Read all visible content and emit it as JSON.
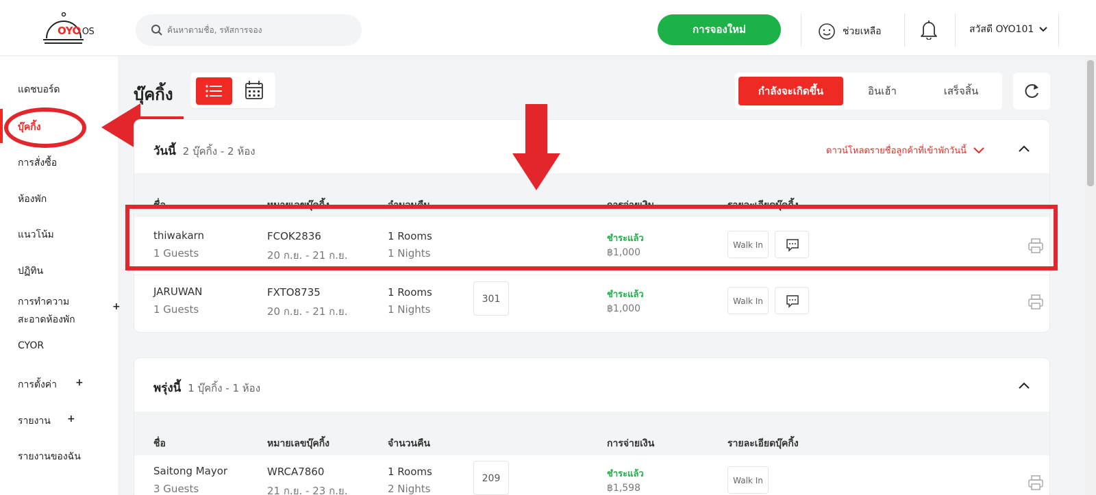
{
  "header": {
    "logo_text": "OYO",
    "logo_os": "OS",
    "search_placeholder": "ค้นหาตามชื่อ, รหัสการจอง",
    "new_booking": "การจองใหม่",
    "help": "ช่วยเหลือ",
    "user": "สวัสดี OYO101"
  },
  "sidebar": {
    "items": [
      {
        "label": "แดชบอร์ด"
      },
      {
        "label": "บุ๊คกิ้ง"
      },
      {
        "label": "การสั่งซื้อ"
      },
      {
        "label": "ห้องพัก"
      },
      {
        "label": "แนวโน้ม"
      },
      {
        "label": "ปฏิทิน"
      },
      {
        "label": "การทำความ"
      },
      {
        "label": "สะอาดห้องพัก"
      },
      {
        "label": "CYOR"
      },
      {
        "label": "การตั้งค่า"
      },
      {
        "label": "รายงาน"
      },
      {
        "label": "รายงานของฉัน"
      }
    ],
    "plus": "+"
  },
  "main": {
    "title": "บุ๊คกิ้ง",
    "tabs": [
      "กำลังจะเกิดขึ้น",
      "อินเฮ้า",
      "เสร็จสิ้น"
    ]
  },
  "columns": {
    "name": "ชื่อ",
    "booking_no": "หมายเลขบุ๊คกิ้ง",
    "nights": "จำนวนคืน",
    "payment": "การจ่ายเงิน",
    "details": "รายละเอียดบุ๊คกิ้ง"
  },
  "today": {
    "title": "วันนี้",
    "sub": "2 บุ๊คกิ้ง - 2 ห้อง",
    "download": "ดาวน์โหลดรายชื่อลูกค้าที่เข้าพักวันนี้",
    "rows": [
      {
        "name": "thiwakarn",
        "guests": "1 Guests",
        "booking": "FCOK2836",
        "dates": "20 ก.ย. - 21 ก.ย.",
        "rooms": "1 Rooms",
        "nights": "1 Nights",
        "room_no": "",
        "paid": "ชำระแล้ว",
        "amount": "฿1,000",
        "walk": "Walk In"
      },
      {
        "name": "JARUWAN",
        "guests": "1 Guests",
        "booking": "FXTO8735",
        "dates": "20 ก.ย. - 21 ก.ย.",
        "rooms": "1 Rooms",
        "nights": "1 Nights",
        "room_no": "301",
        "paid": "ชำระแล้ว",
        "amount": "฿1,000",
        "walk": "Walk In"
      }
    ]
  },
  "tomorrow": {
    "title": "พรุ่งนี้",
    "sub": "1 บุ๊คกิ้ง - 1 ห้อง",
    "rows": [
      {
        "name": "Saitong Mayor",
        "guests": "3 Guests",
        "booking": "WRCA7860",
        "dates": "21 ก.ย. - 23 ก.ย.",
        "rooms": "1 Rooms",
        "nights": "2 Nights",
        "room_no": "209",
        "paid": "ชำระแล้ว",
        "amount": "฿1,598",
        "walk": "Walk In"
      }
    ]
  },
  "colors": {
    "brand_red": "#ee2a24",
    "green": "#1db247",
    "annotation_red": "#e3262b"
  }
}
